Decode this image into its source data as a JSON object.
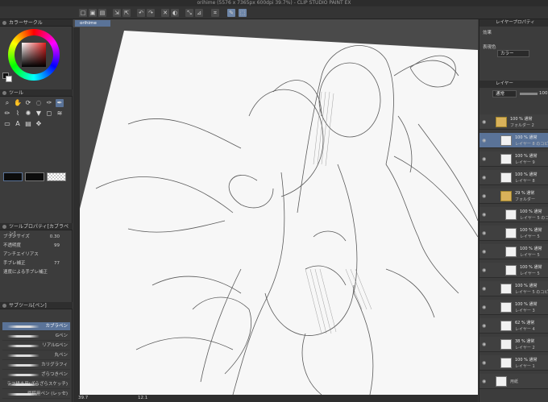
{
  "window": {
    "title": "orihime (5576 x 7365px 600dpi 39.7%) - CLIP STUDIO PAINT EX"
  },
  "toolbar": {
    "icons": [
      "new-icon",
      "open-icon",
      "save-icon",
      "import-icon",
      "export-icon",
      "undo-icon",
      "redo-icon",
      "clear-icon",
      "fill-icon",
      "transform-icon",
      "ruler-icon",
      "snap-icon",
      "pen-icon",
      "select-icon"
    ]
  },
  "left": {
    "color_panel_title": "カラーサークル",
    "tool_panel_title": "ツール",
    "tool_icons": [
      "zoom-icon",
      "hand-icon",
      "rotate-icon",
      "lasso-icon",
      "eyedropper-icon",
      "pen-icon",
      "pencil-icon",
      "brush-icon",
      "airbrush-icon",
      "fill-icon",
      "eraser-icon",
      "blend-icon",
      "figure-icon",
      "text-icon",
      "gradient-icon",
      "move-icon"
    ],
    "prop_panel_title": "ツールプロパティ[カブラペン]",
    "props": [
      {
        "label": "ブラシサイズ",
        "value": "0.30"
      },
      {
        "label": "不透明度",
        "value": "99"
      },
      {
        "label": "アンチエイリアス",
        "value": ""
      },
      {
        "label": "手ブレ補正",
        "value": "77"
      },
      {
        "label": "速度による手ブレ補正",
        "value": ""
      }
    ],
    "subtool_panel_title": "サブツール[ペン]",
    "subtools": [
      {
        "label": "カブラペン"
      },
      {
        "label": "Gペン"
      },
      {
        "label": "リアルGペン"
      },
      {
        "label": "丸ペン"
      },
      {
        "label": "カリグラフィ"
      },
      {
        "label": "ざらつきペン"
      },
      {
        "label": "ラフ描き用(ざらざらスケッチ)"
      },
      {
        "label": "原稿用ペン (レッセ)"
      }
    ]
  },
  "canvas": {
    "tab": "orihime"
  },
  "status": {
    "zoom": "39.7",
    "angle": "12.1"
  },
  "right": {
    "layer_prop_title": "レイヤープロパティ",
    "effect_label": "効果",
    "color_label": "表現色",
    "color_value": "カラー",
    "layer_panel_title": "レイヤー",
    "blend_mode": "通常",
    "opacity": "100",
    "layers": [
      {
        "op": "100 % 通常",
        "name": "フォルダー 2",
        "folder": true,
        "indent": 0
      },
      {
        "op": "100 % 通常",
        "name": "レイヤー 8 のコピー",
        "folder": false,
        "indent": 1,
        "selected": true
      },
      {
        "op": "100 % 通常",
        "name": "レイヤー 9",
        "folder": false,
        "indent": 1
      },
      {
        "op": "100 % 通常",
        "name": "レイヤー 8",
        "folder": false,
        "indent": 1
      },
      {
        "op": "29 % 通常",
        "name": "フォルダー",
        "folder": true,
        "indent": 1
      },
      {
        "op": "100 % 通常",
        "name": "レイヤー 5 のコピー",
        "folder": false,
        "indent": 2
      },
      {
        "op": "100 % 通常",
        "name": "レイヤー 5",
        "folder": false,
        "indent": 2
      },
      {
        "op": "100 % 通常",
        "name": "レイヤー 5",
        "folder": false,
        "indent": 2
      },
      {
        "op": "100 % 通常",
        "name": "レイヤー 5",
        "folder": false,
        "indent": 2
      },
      {
        "op": "100 % 通常",
        "name": "レイヤー 5 のコピー",
        "folder": false,
        "indent": 1
      },
      {
        "op": "100 % 通常",
        "name": "レイヤー 3",
        "folder": false,
        "indent": 1
      },
      {
        "op": "62 % 通常",
        "name": "レイヤー 4",
        "folder": false,
        "indent": 1
      },
      {
        "op": "38 % 通常",
        "name": "レイヤー 2",
        "folder": false,
        "indent": 1
      },
      {
        "op": "100 % 通常",
        "name": "レイヤー 1",
        "folder": false,
        "indent": 1
      },
      {
        "op": "",
        "name": "用紙",
        "folder": false,
        "indent": 0
      }
    ]
  }
}
